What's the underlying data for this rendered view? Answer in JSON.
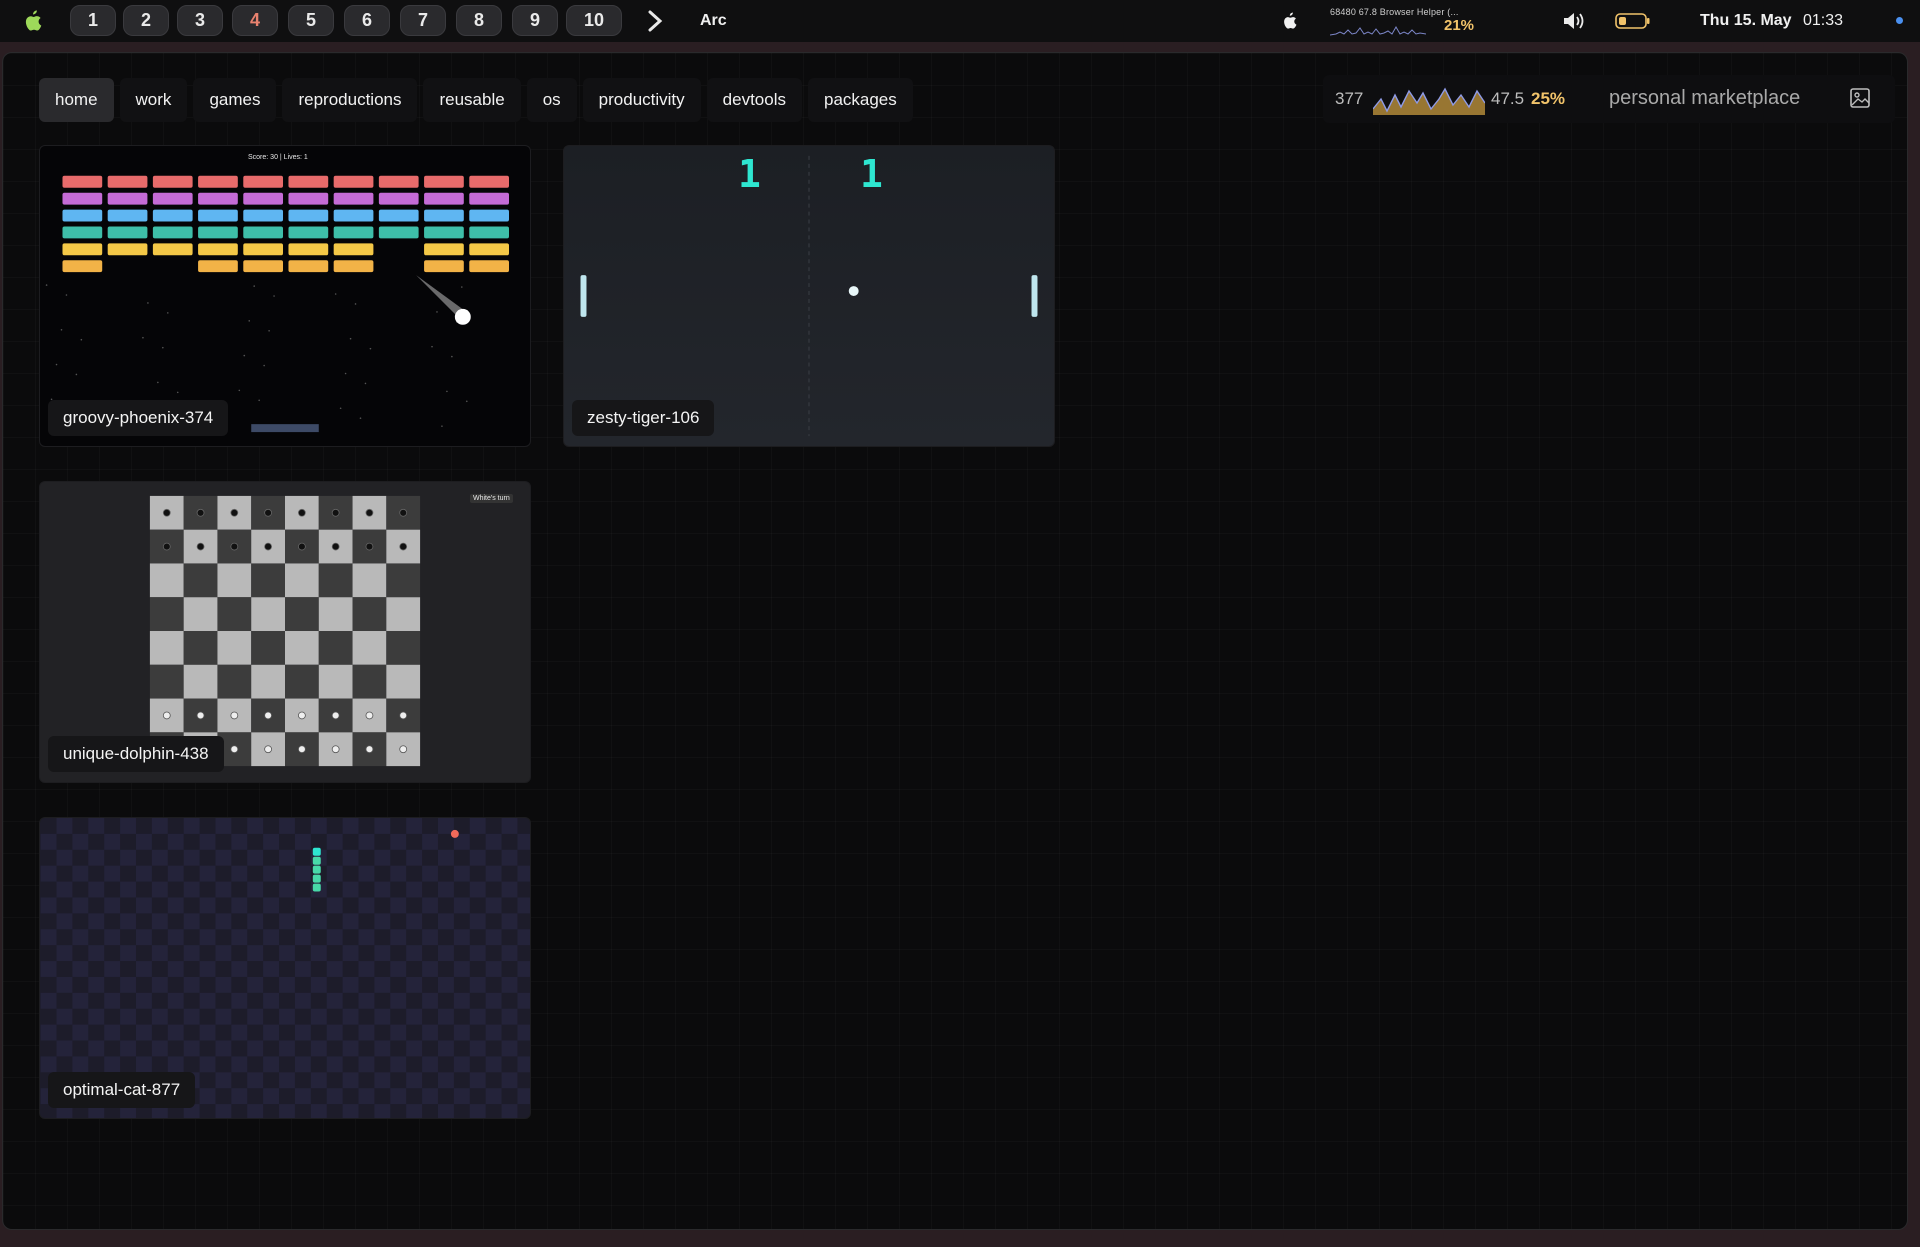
{
  "menubar": {
    "workspaces": [
      "1",
      "2",
      "3",
      "4",
      "5",
      "6",
      "7",
      "8",
      "9",
      "10"
    ],
    "active_workspace": "4",
    "app_name": "Arc",
    "cpu_text": "68480  67.8 Browser Helper (...",
    "cpu_percent": "21%",
    "date": "Thu 15. May",
    "time": "01:33"
  },
  "nav": {
    "items": [
      "home",
      "work",
      "games",
      "reproductions",
      "reusable",
      "os",
      "productivity",
      "devtools",
      "packages"
    ],
    "active": "home"
  },
  "tools": {
    "count_left": "377",
    "count_right": "47.5",
    "percent": "25%",
    "marketplace_label": "personal marketplace"
  },
  "cards": [
    {
      "name": "groovy-phoenix-374",
      "game": "breakout",
      "hud": "Score: 30   |   Lives: 1"
    },
    {
      "name": "zesty-tiger-106",
      "game": "pong",
      "score_left": "1",
      "score_right": "1"
    },
    {
      "name": "unique-dolphin-438",
      "game": "chess",
      "status": "White's turn"
    },
    {
      "name": "optimal-cat-877",
      "game": "snake"
    }
  ],
  "colors": {
    "accent_teal": "#2ee6d0",
    "warn_yellow": "#f1c36a",
    "active_ws": "#e9826f",
    "brick_rows": [
      "#e86b6b",
      "#c46bd6",
      "#5fb6f2",
      "#3ebfa9",
      "#f4c847",
      "#f2b347"
    ]
  }
}
